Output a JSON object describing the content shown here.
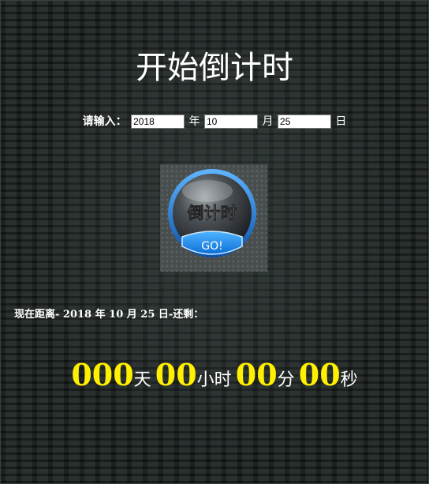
{
  "title": "开始倒计时",
  "form": {
    "prompt": "请输入：",
    "year_value": "2018",
    "year_unit": "年",
    "month_value": "10",
    "month_unit": "月",
    "day_value": "25",
    "day_unit": "日"
  },
  "go_button": {
    "label_top": "倒计时",
    "label_bottom": "GO!"
  },
  "status": {
    "text": "现在距离- 2018 年 10 月 25 日-还剩："
  },
  "countdown": {
    "days": "000",
    "days_unit": "天",
    "hours": "00",
    "hours_unit": "小时",
    "minutes": "00",
    "minutes_unit": "分",
    "seconds": "00",
    "seconds_unit": "秒"
  },
  "colors": {
    "number": "#ffef00",
    "button_blue": "#1e8fe6"
  }
}
